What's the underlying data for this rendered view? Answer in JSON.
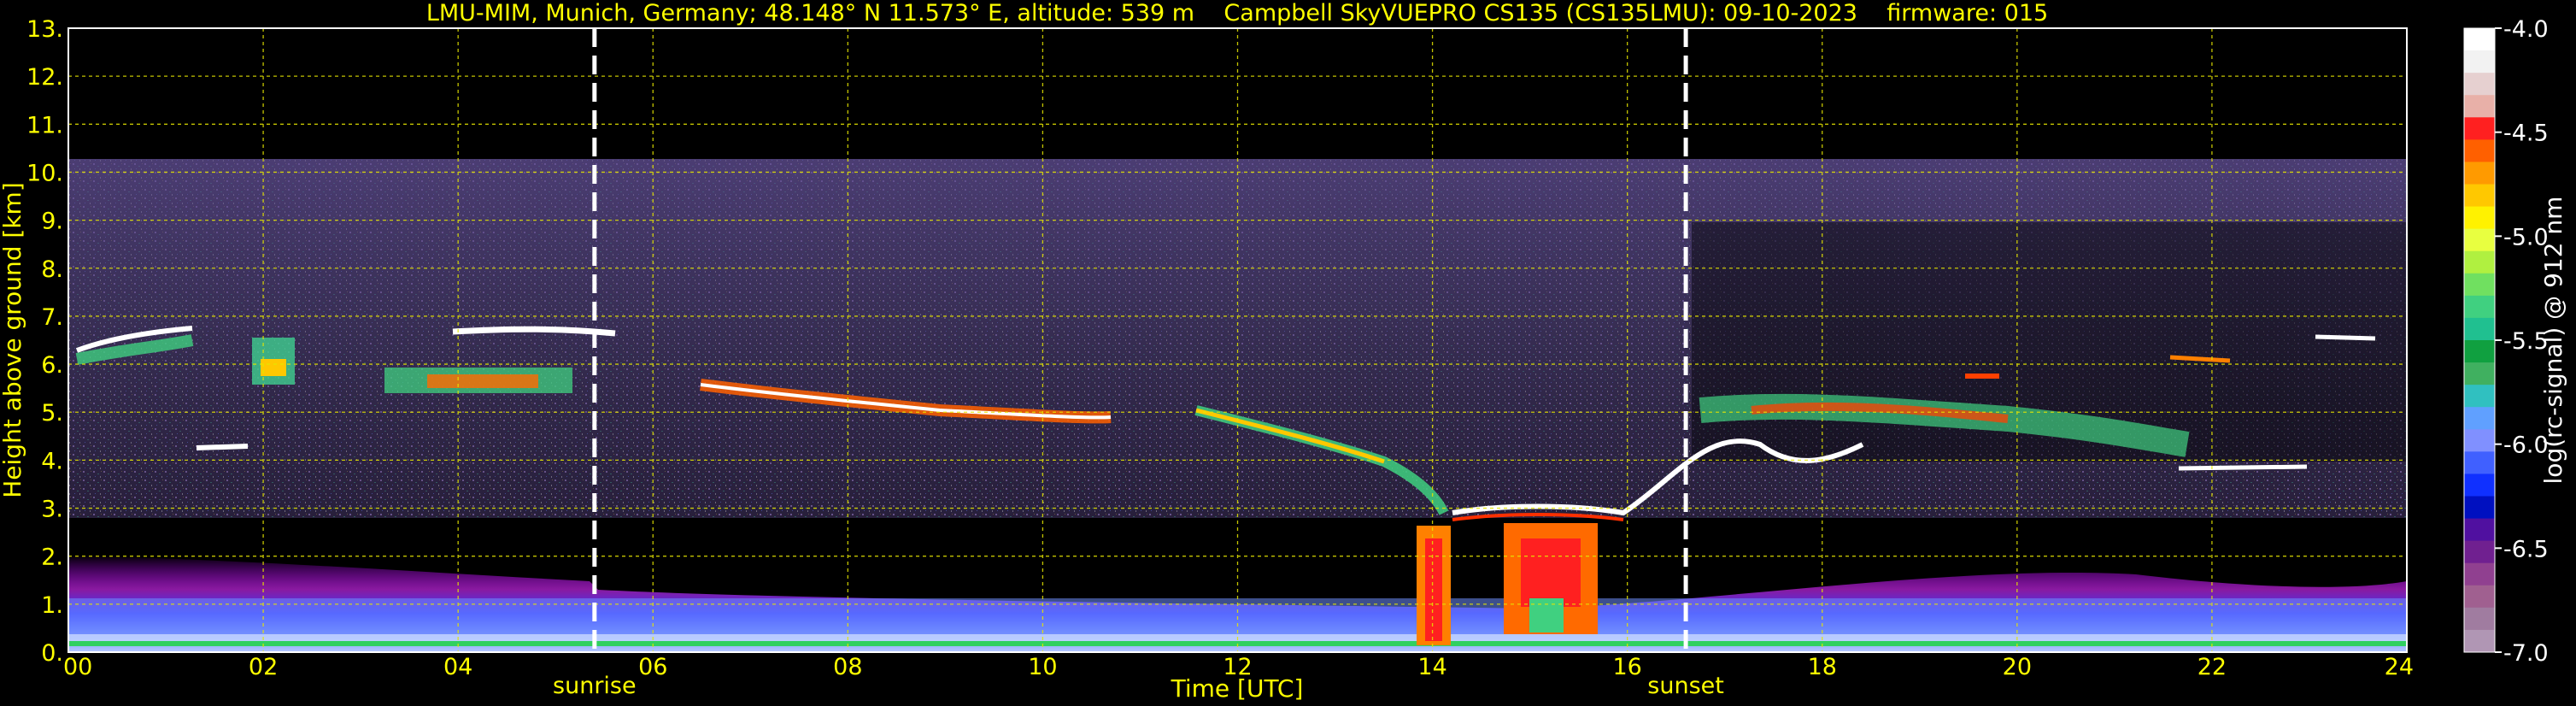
{
  "chart_data": {
    "type": "heatmap",
    "title": "LMU-MIM, Munich, Germany; 48.148° N 11.573° E, altitude: 539 m    Campbell SkyVUEPRO CS135 (CS135LMU): 09-10-2023    firmware: 015",
    "xlabel": "Time [UTC]",
    "ylabel": "Height above ground [km]",
    "xlim": [
      0,
      24
    ],
    "ylim": [
      0,
      13
    ],
    "x_ticks": [
      "00",
      "02",
      "04",
      "06",
      "08",
      "10",
      "12",
      "14",
      "16",
      "18",
      "20",
      "22",
      "24"
    ],
    "y_ticks": [
      "0.",
      "1.",
      "2.",
      "3.",
      "4.",
      "5.",
      "6.",
      "7.",
      "8.",
      "9.",
      "10.",
      "11.",
      "12.",
      "13."
    ],
    "grid": true,
    "markers": [
      {
        "label": "sunrise",
        "x": 5.4
      },
      {
        "label": "sunset",
        "x": 16.6
      }
    ],
    "colorbar": {
      "label": "log(rc-signal) @ 912 nm",
      "range": [
        -7.0,
        -4.0
      ],
      "ticks": [
        "-4.0",
        "-4.5",
        "-5.0",
        "-5.5",
        "-6.0",
        "-6.5",
        "-7.0"
      ],
      "colors": [
        "#ffffff",
        "#f2f2f2",
        "#e6d0d0",
        "#e8b0a8",
        "#ff2020",
        "#ff6000",
        "#ff9a00",
        "#ffc800",
        "#fff200",
        "#e8ff40",
        "#b0f040",
        "#70e060",
        "#40d080",
        "#20c090",
        "#10a040",
        "#40b060",
        "#30c0c0",
        "#60a0ff",
        "#8090ff",
        "#4060ff",
        "#1030ff",
        "#0010c0",
        "#5010a0",
        "#702090",
        "#904090",
        "#a06090",
        "#a07ca0",
        "#b096b4"
      ]
    },
    "data_summary": "ceilometer attenuated backscatter time–height cross-section; boundary layer below ~2 km, cloud layers 3.5–7 km, precipitation near 14–15 UTC"
  }
}
